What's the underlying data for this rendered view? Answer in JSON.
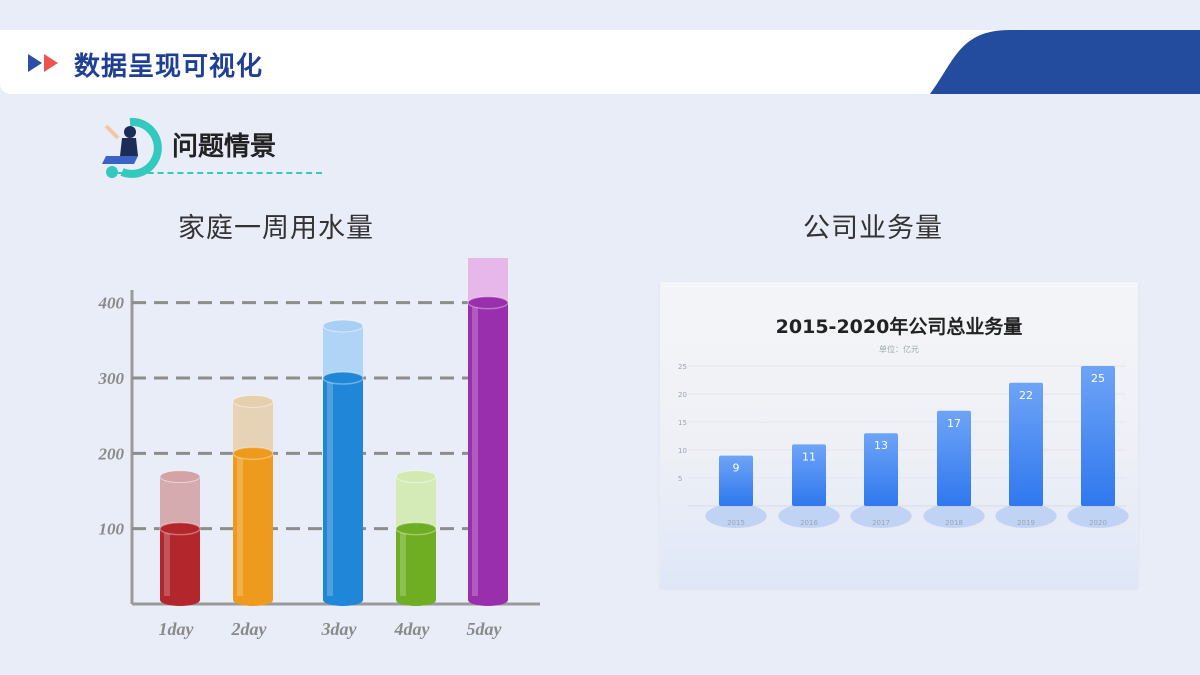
{
  "header": {
    "title": "数据呈现可视化"
  },
  "section": {
    "title": "问题情景"
  },
  "chart_left": {
    "title": "家庭一周用水量"
  },
  "chart_right": {
    "title": "公司业务量",
    "panel_title": "2015-2020年公司总业务量",
    "unit": "单位：亿元"
  },
  "colors": {
    "brand": "#1e3f93",
    "accent": "#ef5350",
    "teal": "#33c9be",
    "bar_blue": "#2f7cf0"
  },
  "chart_data": [
    {
      "type": "bar",
      "title": "家庭一周用水量",
      "categories": [
        "1day",
        "2day",
        "3day",
        "4day",
        "5day"
      ],
      "values": [
        100,
        200,
        300,
        100,
        400
      ],
      "y_ticks": [
        100,
        200,
        300,
        400
      ],
      "ylim": [
        0,
        400
      ],
      "colors": [
        "#b3262c",
        "#ee9a1c",
        "#1f86d8",
        "#6fae22",
        "#9a2fae"
      ],
      "caps": [
        "#d4a3a6",
        "#e6cfad",
        "#a9d0f4",
        "#d2eab0",
        "#e6b0e6"
      ]
    },
    {
      "type": "bar",
      "title": "2015-2020年公司总业务量",
      "subtitle": "单位：亿元",
      "categories": [
        "2015",
        "2016",
        "2017",
        "2018",
        "2019",
        "2020"
      ],
      "values": [
        9,
        11,
        13,
        17,
        22,
        25
      ],
      "y_ticks": [
        5,
        10,
        15,
        20,
        25
      ],
      "ylim": [
        0,
        25
      ]
    }
  ]
}
